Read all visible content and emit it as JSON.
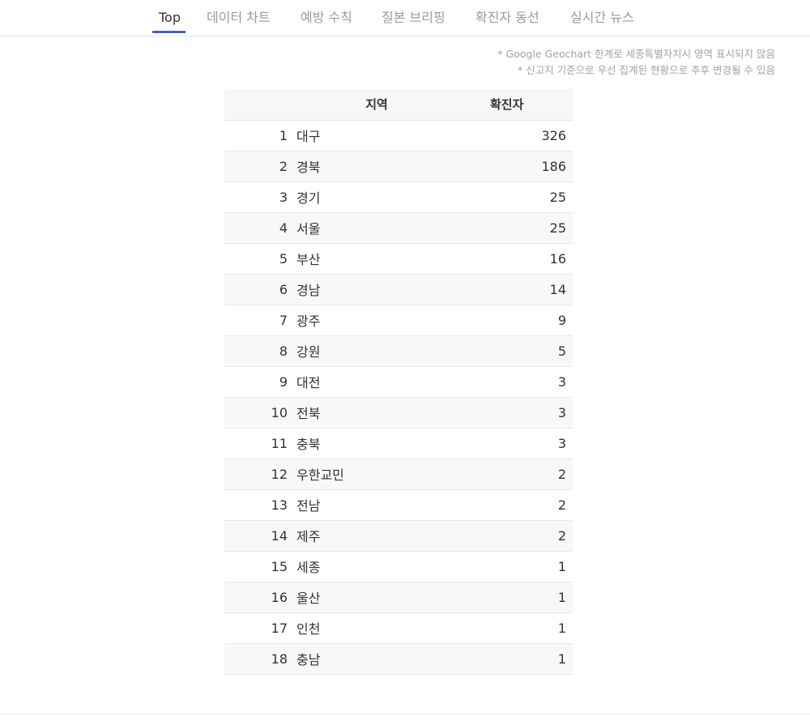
{
  "tabs": [
    {
      "label": "Top"
    },
    {
      "label": "데이터 차트"
    },
    {
      "label": "예방 수칙"
    },
    {
      "label": "질본 브리핑"
    },
    {
      "label": "확진자 동선"
    },
    {
      "label": "실시간 뉴스"
    }
  ],
  "notes": {
    "line1": "* Google Geochart 한계로 세종특별자치시 영역 표시되지 않음",
    "line2": "* 신고지 기준으로 우선 집계된 현황으로 추후 변경될 수 있음"
  },
  "table": {
    "headers": {
      "rank": "",
      "region": "지역",
      "count": "확진자"
    },
    "rows": [
      {
        "rank": "1",
        "region": "대구",
        "count": "326"
      },
      {
        "rank": "2",
        "region": "경북",
        "count": "186"
      },
      {
        "rank": "3",
        "region": "경기",
        "count": "25"
      },
      {
        "rank": "4",
        "region": "서울",
        "count": "25"
      },
      {
        "rank": "5",
        "region": "부산",
        "count": "16"
      },
      {
        "rank": "6",
        "region": "경남",
        "count": "14"
      },
      {
        "rank": "7",
        "region": "광주",
        "count": "9"
      },
      {
        "rank": "8",
        "region": "강원",
        "count": "5"
      },
      {
        "rank": "9",
        "region": "대전",
        "count": "3"
      },
      {
        "rank": "10",
        "region": "전북",
        "count": "3"
      },
      {
        "rank": "11",
        "region": "충북",
        "count": "3"
      },
      {
        "rank": "12",
        "region": "우한교민",
        "count": "2"
      },
      {
        "rank": "13",
        "region": "전남",
        "count": "2"
      },
      {
        "rank": "14",
        "region": "제주",
        "count": "2"
      },
      {
        "rank": "15",
        "region": "세종",
        "count": "1"
      },
      {
        "rank": "16",
        "region": "울산",
        "count": "1"
      },
      {
        "rank": "17",
        "region": "인천",
        "count": "1"
      },
      {
        "rank": "18",
        "region": "충남",
        "count": "1"
      }
    ]
  },
  "colors": {
    "accent": "#3f63c8",
    "tab_inactive": "#9a9a9a",
    "note_text": "#a2a2a2",
    "header_bg": "#f7f7f9"
  }
}
